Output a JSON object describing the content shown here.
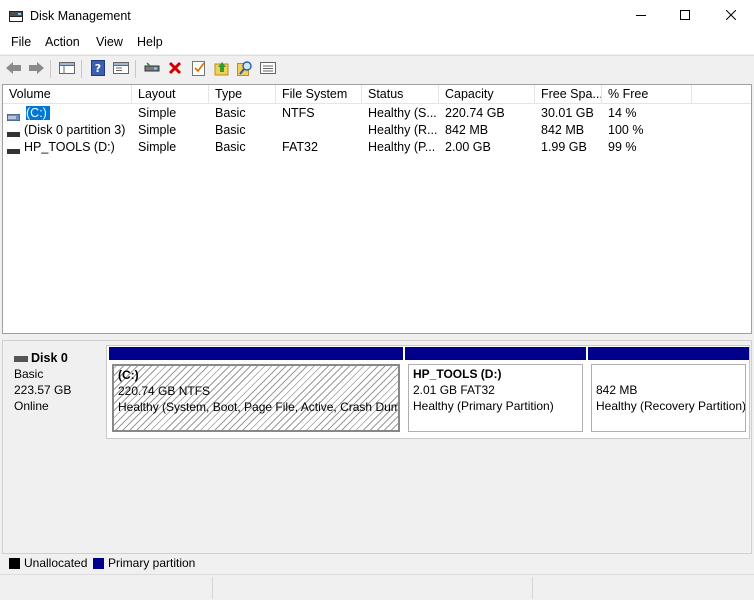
{
  "window": {
    "title": "Disk Management",
    "controls": {
      "minimize": "minimize-icon",
      "maximize": "maximize-icon",
      "close": "close-icon"
    }
  },
  "menu": [
    {
      "label": "File"
    },
    {
      "label": "Action"
    },
    {
      "label": "View"
    },
    {
      "label": "Help"
    }
  ],
  "toolbar": [
    "back-arrow-icon",
    "forward-arrow-icon",
    "show-hide-console-tree-icon",
    "help-icon",
    "show-hide-action-pane-icon",
    "connect-virtual-disk-icon",
    "delete-icon",
    "check-properties-icon",
    "up-folder-icon",
    "search-disk-icon",
    "list-view-icon"
  ],
  "volume_list": {
    "columns": [
      "Volume",
      "Layout",
      "Type",
      "File System",
      "Status",
      "Capacity",
      "Free Spa...",
      "% Free"
    ],
    "rows": [
      {
        "volume": "(C:)",
        "layout": "Simple",
        "type": "Basic",
        "file_system": "NTFS",
        "status": "Healthy (S...",
        "capacity": "220.74 GB",
        "free_space": "30.01 GB",
        "percent_free": "14 %",
        "selected": true
      },
      {
        "volume": "(Disk 0 partition 3)",
        "layout": "Simple",
        "type": "Basic",
        "file_system": "",
        "status": "Healthy (R...",
        "capacity": "842 MB",
        "free_space": "842 MB",
        "percent_free": "100 %",
        "selected": false
      },
      {
        "volume": "HP_TOOLS (D:)",
        "layout": "Simple",
        "type": "Basic",
        "file_system": "FAT32",
        "status": "Healthy (P...",
        "capacity": "2.00 GB",
        "free_space": "1.99 GB",
        "percent_free": "99 %",
        "selected": false
      }
    ]
  },
  "disk": {
    "name": "Disk 0",
    "type": "Basic",
    "size": "223.57 GB",
    "state": "Online",
    "partitions": [
      {
        "name": "(C:)",
        "size_fs": "220.74 GB NTFS",
        "status": "Healthy (System, Boot, Page File, Active, Crash Dump"
      },
      {
        "name": "HP_TOOLS  (D:)",
        "size_fs": "2.01 GB FAT32",
        "status": "Healthy (Primary Partition)"
      },
      {
        "name": "",
        "size_fs": "842 MB",
        "status": "Healthy (Recovery Partition)"
      }
    ]
  },
  "legend": [
    {
      "label": "Unallocated",
      "color": "#000000"
    },
    {
      "label": "Primary partition",
      "color": "#00008b"
    }
  ],
  "colors": {
    "partition_band": "#00008b",
    "selection": "#0078d7"
  }
}
